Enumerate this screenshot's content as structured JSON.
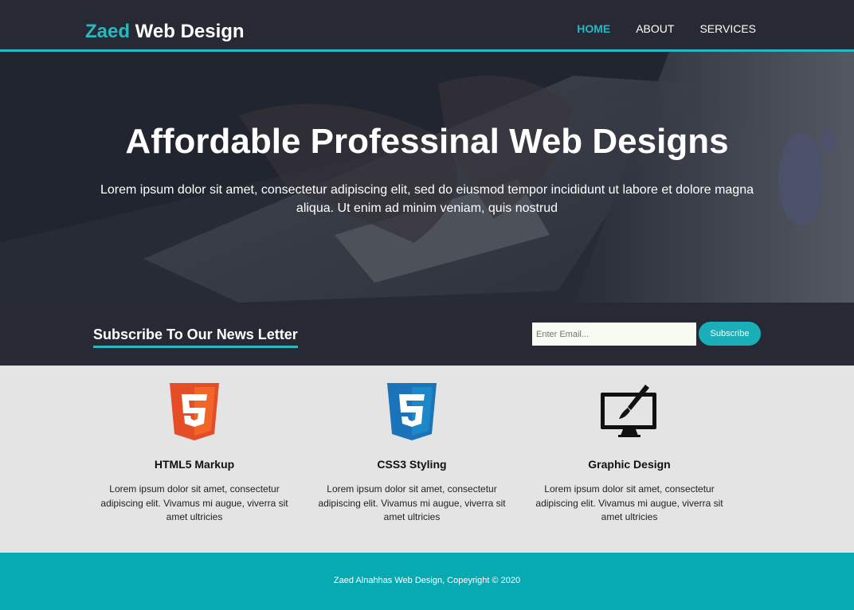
{
  "brand": {
    "accent": "Zaed",
    "rest": " Web Design"
  },
  "nav": [
    {
      "label": "HOME",
      "active": true
    },
    {
      "label": "ABOUT",
      "active": false
    },
    {
      "label": "SERVICES",
      "active": false
    }
  ],
  "hero": {
    "title": "Affordable Professinal Web Designs",
    "text": "Lorem ipsum dolor sit amet, consectetur adipiscing elit, sed do eiusmod tempor incididunt ut labore et dolore magna aliqua. Ut enim ad minim veniam, quis nostrud"
  },
  "newsletter": {
    "title": "Subscribe To Our News Letter",
    "email_placeholder": "Enter Email...",
    "button_label": "Subscribe"
  },
  "features": [
    {
      "icon": "html5-icon",
      "title": "HTML5 Markup",
      "text": "Lorem ipsum dolor sit amet, consectetur adipiscing elit. Vivamus mi augue, viverra sit amet ultricies"
    },
    {
      "icon": "css3-icon",
      "title": "CSS3 Styling",
      "text": "Lorem ipsum dolor sit amet, consectetur adipiscing elit. Vivamus mi augue, viverra sit amet ultricies"
    },
    {
      "icon": "graphic-design-icon",
      "title": "Graphic Design",
      "text": "Lorem ipsum dolor sit amet, consectetur adipiscing elit. Vivamus mi augue, viverra sit amet ultricies"
    }
  ],
  "footer": {
    "text": "Zaed Alnahhas Web Design, Copeyright © 2020"
  },
  "colors": {
    "accent": "#2bb7c0",
    "dark": "#272a35",
    "footer": "#07aab3",
    "html5": "#e44d26",
    "css3": "#264de4"
  }
}
